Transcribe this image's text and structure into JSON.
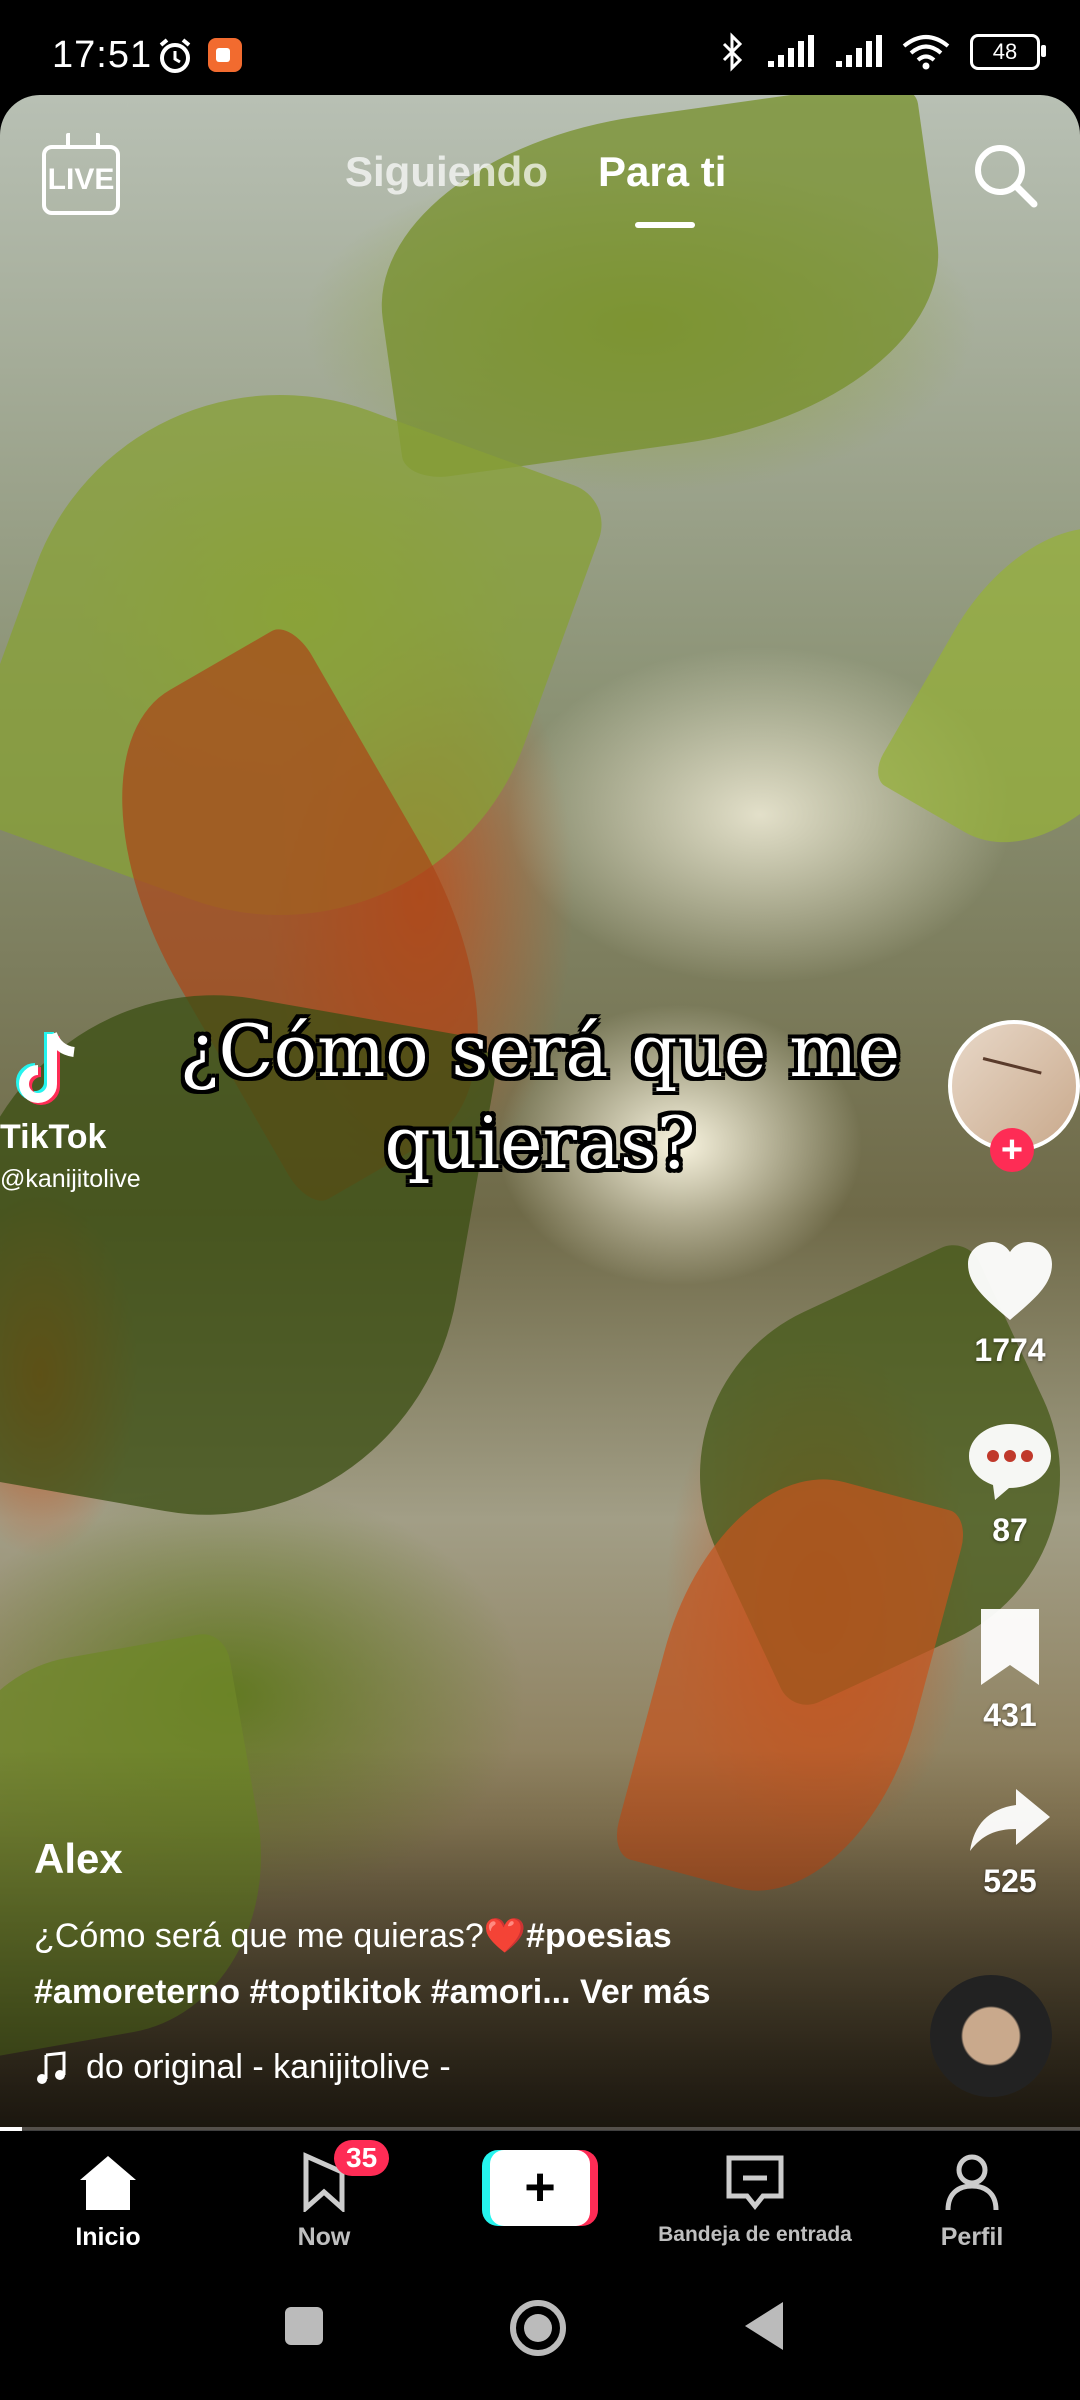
{
  "status_bar": {
    "time": "17:51",
    "battery": "48",
    "icons": [
      "alarm-icon",
      "screen-record-icon",
      "bluetooth-icon",
      "signal-icon",
      "signal-icon",
      "wifi-icon",
      "battery-icon"
    ]
  },
  "top_nav": {
    "live_label": "LIVE",
    "tabs": [
      {
        "label": "Siguiendo",
        "active": false
      },
      {
        "label": "Para ti",
        "active": true
      }
    ]
  },
  "video": {
    "overlay_text": "¿Cómo será que me quieras?",
    "watermark": {
      "brand": "TikTok",
      "handle": "@kanijitolive"
    },
    "progress_fraction": 0.02
  },
  "actions": {
    "likes": "1774",
    "comments": "87",
    "saves": "431",
    "shares": "525"
  },
  "post": {
    "username": "Alex",
    "description_text": "¿Cómo será que me quieras?",
    "emoji": "❤️",
    "hashtag_1": "#poesias",
    "hashtags_line2": "#amoreterno #toptikitok #amori...",
    "see_more": "Ver más",
    "music": "do original - kanijitolive -"
  },
  "bottom_nav": {
    "items": [
      {
        "label": "Inicio",
        "active": true
      },
      {
        "label": "Now",
        "badge": "35"
      },
      {
        "label": "+"
      },
      {
        "label": "Bandeja de entrada"
      },
      {
        "label": "Perfil"
      }
    ]
  },
  "colors": {
    "accent_red": "#fe2c55",
    "accent_cyan": "#25f4ee",
    "record_orange": "#f26b2f"
  }
}
